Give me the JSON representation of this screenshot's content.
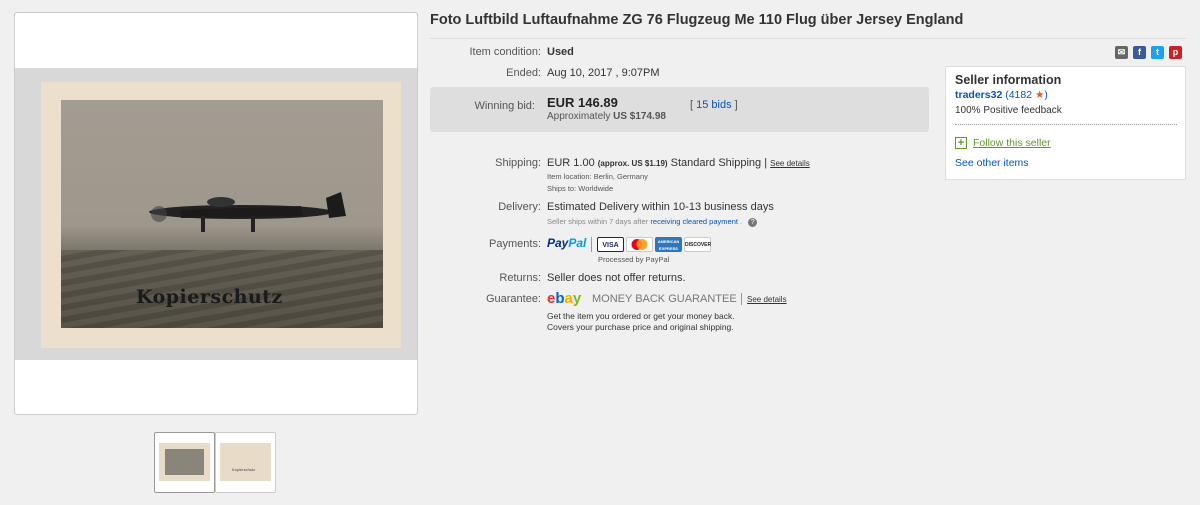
{
  "title": "Foto Luftbild Luftaufnahme ZG 76 Flugzeug Me 110 Flug über Jersey England",
  "image": {
    "watermark": "Kopierschutz"
  },
  "item": {
    "condition_label": "Item condition:",
    "condition_value": "Used",
    "ended_label": "Ended:",
    "ended_value": "Aug 10, 2017 , 9:07PM"
  },
  "bid": {
    "label": "Winning bid:",
    "price": "EUR 146.89",
    "approx_prefix": "Approximately",
    "approx_value": "US $174.98",
    "bids_open": "[",
    "bids_link": "15 bids",
    "bids_close": "]"
  },
  "shipping": {
    "label": "Shipping:",
    "cost": "EUR 1.00",
    "approx": "(approx. US $1.19)",
    "method": "Standard Shipping |",
    "details_link": "See details",
    "location": "Item location:  Berlin, Germany",
    "ships_to": "Ships to:  Worldwide"
  },
  "delivery": {
    "label": "Delivery:",
    "estimate": "Estimated Delivery within 10-13 business days",
    "note_prefix": "Seller ships within 7 days after",
    "note_link": "receiving cleared payment",
    "note_suffix": "."
  },
  "payments": {
    "label": "Payments:",
    "paypal": "PayPal",
    "processed": "Processed by PayPal",
    "cards": [
      "VISA",
      "MasterCard",
      "AMERICAN EXPRESS",
      "DISCOVER"
    ]
  },
  "returns": {
    "label": "Returns:",
    "value": "Seller does not offer returns."
  },
  "guarantee": {
    "label": "Guarantee:",
    "brand": "ebay",
    "text": "MONEY BACK GUARANTEE",
    "details_link": "See details",
    "line1": "Get the item you ordered or get your money back.",
    "line2": "Covers your purchase price and original shipping."
  },
  "seller": {
    "title": "Seller information",
    "name": "traders32",
    "score": "(4182",
    "score_close": ")",
    "feedback": "100% Positive feedback",
    "follow": "Follow this seller",
    "other_items": "See other items"
  },
  "share_icons": [
    "email-icon",
    "facebook-icon",
    "twitter-icon",
    "pinterest-icon"
  ]
}
